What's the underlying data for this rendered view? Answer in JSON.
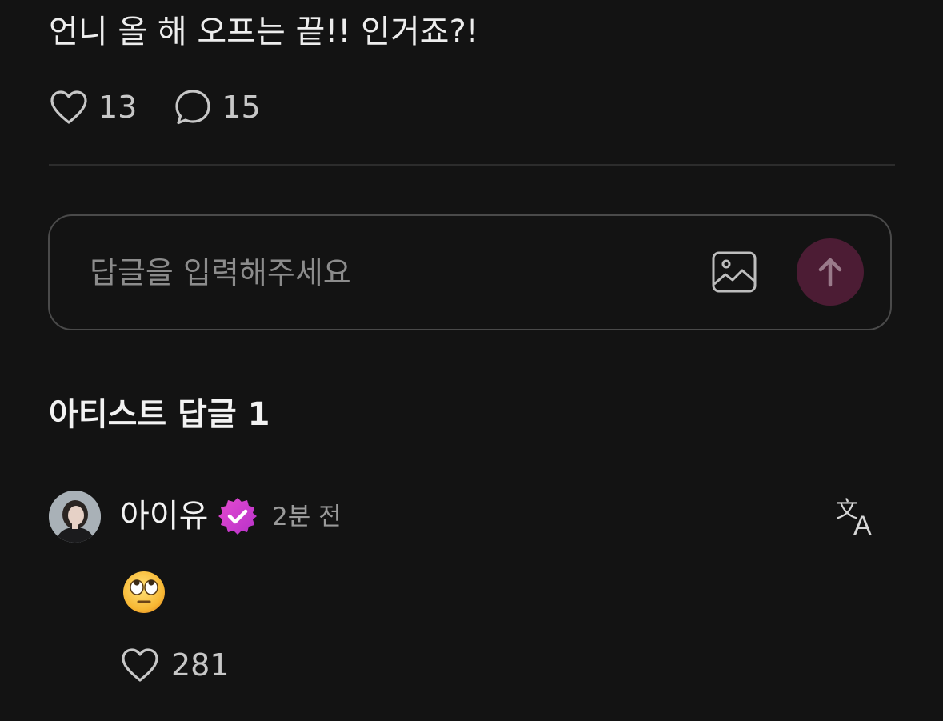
{
  "post": {
    "text": "언니 올 해 오프는 끝!! 인거죠?!",
    "like_count": "13",
    "comment_count": "15"
  },
  "reply_box": {
    "placeholder": "답글을 입력해주세요",
    "value": ""
  },
  "artist_replies": {
    "section_title": "아티스트 답글 1",
    "items": [
      {
        "author": "아이유",
        "verified": true,
        "timestamp": "2분 전",
        "content_emoji": "face-with-rolling-eyes",
        "like_count": "281"
      }
    ]
  },
  "icons": {
    "like": "heart-outline-icon",
    "comment": "speech-bubble-icon",
    "image": "image-icon",
    "send": "arrow-up-icon",
    "translate": "translate-icon",
    "verified": "verified-badge-icon"
  },
  "colors": {
    "background": "#131313",
    "text": "#ededed",
    "muted": "#c7c7c7",
    "send_button": "#4c1c34",
    "verified_badge": "#d43fc9"
  }
}
